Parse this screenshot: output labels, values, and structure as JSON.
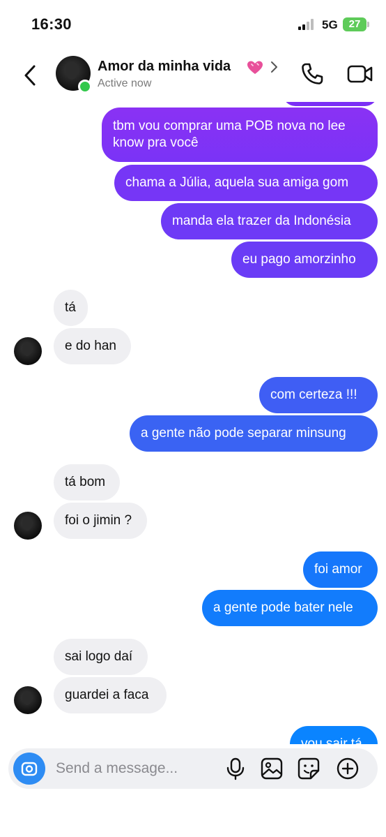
{
  "status_bar": {
    "time": "16:30",
    "network": "5G",
    "battery": "27"
  },
  "header": {
    "contact_name": "Amor da minha vida",
    "status": "Active now",
    "name_emoji_icon": "sparkling-heart-icon"
  },
  "colors": {
    "sent_top": "#7b2ff5",
    "sent_mid": "#2f6df4",
    "sent_bottom": "#0a84ff",
    "received_bg": "#efeff2",
    "online": "#32c84b",
    "camera_button": "#2e8cf3"
  },
  "messages": [
    {
      "side": "sent",
      "text": "tbm vou comprar uma POB nova no lee know pra você"
    },
    {
      "side": "sent",
      "text": "chama a Júlia, aquela sua amiga gom"
    },
    {
      "side": "sent",
      "text": "manda ela trazer da Indonésia"
    },
    {
      "side": "sent",
      "text": "eu pago amorzinho"
    },
    {
      "side": "received",
      "text": "tá"
    },
    {
      "side": "received",
      "text": "e do han"
    },
    {
      "side": "sent",
      "text": "com certeza !!!"
    },
    {
      "side": "sent",
      "text": "a gente não pode separar minsung"
    },
    {
      "side": "received",
      "text": "tá bom"
    },
    {
      "side": "received",
      "text": "foi o jimin ?"
    },
    {
      "side": "sent",
      "text": "foi amor"
    },
    {
      "side": "sent",
      "text": "a gente pode bater nele"
    },
    {
      "side": "received",
      "text": "sai logo daí"
    },
    {
      "side": "received",
      "text": "guardei a faca"
    },
    {
      "side": "sent",
      "text": "vou sair tá"
    }
  ],
  "composer": {
    "placeholder": "Send a message..."
  }
}
